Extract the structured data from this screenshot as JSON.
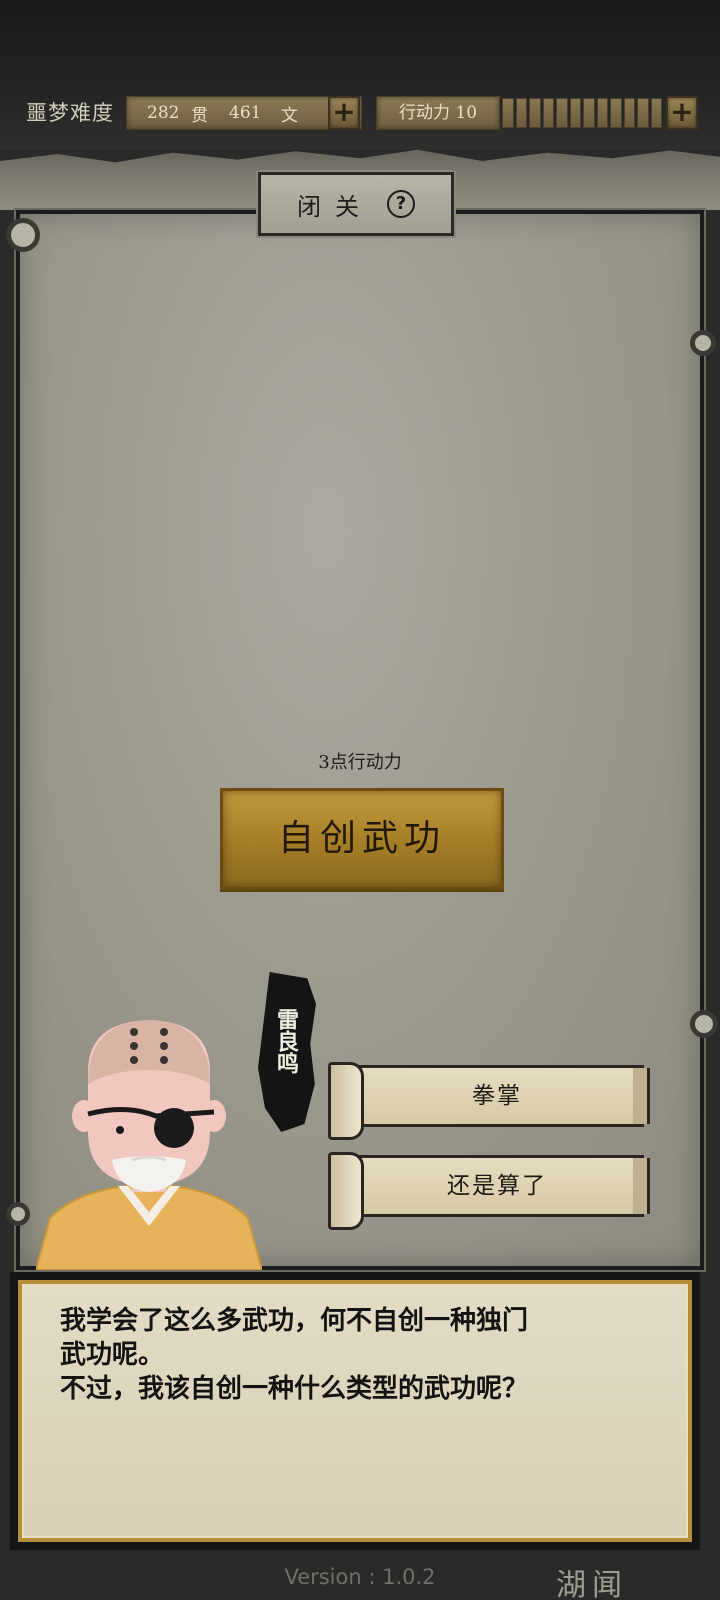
{
  "topbar": {
    "difficulty": "噩梦难度",
    "money": {
      "guan_value": "282",
      "guan_unit": "贯",
      "wen_value": "461",
      "wen_unit": "文"
    },
    "energy_label": "行动力 10",
    "energy_segments": 12,
    "plus_symbol": "+"
  },
  "panel": {
    "title": "闭关",
    "help_symbol": "?",
    "cost_text": "3点行动力",
    "create_button": "自创武功"
  },
  "character": {
    "name": "雷良鸣",
    "options": [
      "拳掌",
      "还是算了"
    ]
  },
  "dialog": {
    "lines": [
      "我学会了这么多武功，何不自创一种独门",
      "武功呢。",
      "不过，我该自创一种什么类型的武功呢？"
    ]
  },
  "footer": {
    "version": "Version : 1.0.2",
    "corner": "湖闻"
  },
  "colors": {
    "gold_button": "#a57d27",
    "panel_paper": "#9c998e",
    "dialog_border": "#b38f3e"
  }
}
